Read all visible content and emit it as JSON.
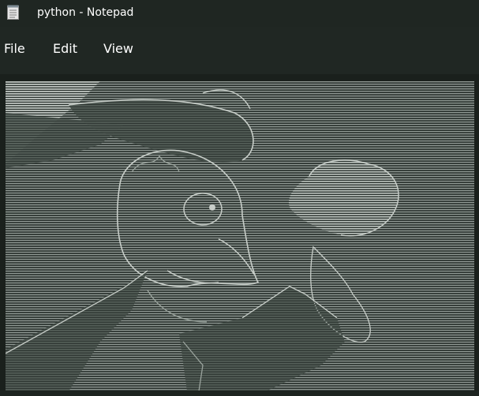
{
  "window": {
    "title": "python - Notepad",
    "icon": "notepad-icon"
  },
  "menu": {
    "items": [
      {
        "label": "File"
      },
      {
        "label": "Edit"
      },
      {
        "label": "View"
      }
    ]
  },
  "document": {
    "content_kind": "ascii-art",
    "palette": {
      "background": "#262e2a",
      "ink_light": "#c8cec9",
      "ink_mid": "#9aa39d",
      "ink_dark": "#4b554f"
    }
  }
}
